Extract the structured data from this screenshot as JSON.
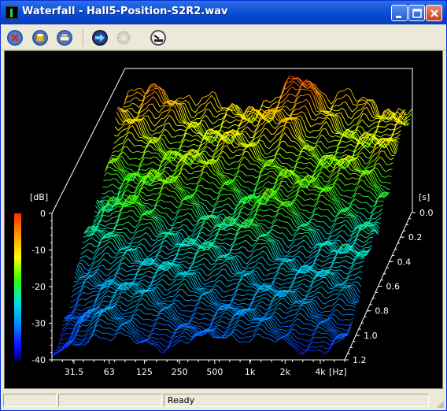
{
  "window": {
    "title": "Waterfall - Hall5-Position-S2R2.wav"
  },
  "titlebar_buttons": [
    {
      "name": "minimize-button",
      "icon": "minimize-icon"
    },
    {
      "name": "maximize-button",
      "icon": "maximize-icon"
    },
    {
      "name": "close-button",
      "icon": "close-icon"
    }
  ],
  "toolbar": [
    {
      "name": "cancel-tool-button",
      "icon": "red-x-icon",
      "enabled": true
    },
    {
      "name": "save-tool-button",
      "icon": "disk-icon",
      "enabled": true
    },
    {
      "name": "print-tool-button",
      "icon": "printer-icon",
      "enabled": true
    },
    {
      "name": "forward-tool-button",
      "icon": "arrow-right-icon",
      "enabled": true
    },
    {
      "name": "disabled-tool-button",
      "icon": "gear-icon",
      "enabled": false
    },
    {
      "name": "settings-tool-button",
      "icon": "gauge-icon",
      "enabled": true
    }
  ],
  "plot": {
    "db_unit": "[dB]",
    "db_ticks": [
      "0",
      "-10",
      "-20",
      "-30",
      "-40"
    ],
    "time_unit": "[s]",
    "time_ticks": [
      "0.0",
      "0.2",
      "0.4",
      "0.6",
      "0.8",
      "1.0",
      "1.2"
    ],
    "freq_ticks": [
      "31.5",
      "63",
      "125",
      "250",
      "500",
      "1k",
      "2k",
      "4k"
    ],
    "freq_unit": "[Hz]",
    "colors": {
      "background": "#000000",
      "axis": "#ffffff"
    }
  },
  "status": {
    "text": "Ready"
  }
}
